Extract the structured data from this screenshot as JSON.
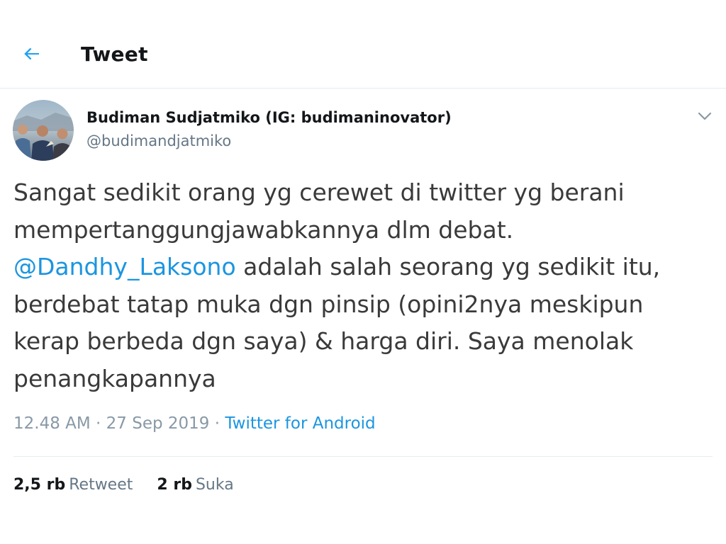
{
  "header": {
    "title": "Tweet",
    "back_icon": "arrow-left-icon",
    "accent_color": "#1da1f2"
  },
  "author": {
    "name": "Budiman Sudjatmiko (IG: budimaninovator)",
    "handle": "@budimandjatmiko",
    "avatar": "profile-photo"
  },
  "menu": {
    "icon": "chevron-down-icon"
  },
  "tweet": {
    "lines": [
      {
        "text": "Sangat sedikit orang yg cerewet di twitter yg berani"
      },
      {
        "text": "mempertanggungjawabkannya dlm debat."
      },
      {
        "mention": "@Dandhy_Laksono",
        "text": " adalah salah seorang yg sedikit itu,"
      },
      {
        "text": "berdebat tatap muka dgn pinsip (opini2nya meskipun"
      },
      {
        "text": "kerap berbeda dgn saya) & harga diri. Saya menolak"
      },
      {
        "text": "penangkapannya"
      }
    ]
  },
  "meta": {
    "time": "12.48 AM",
    "separator": " · ",
    "date": "27 Sep 2019",
    "source": "Twitter for Android"
  },
  "stats": {
    "retweets_count": "2,5 rb",
    "retweets_label": "Retweet",
    "likes_count": "2 rb",
    "likes_label": "Suka"
  },
  "colors": {
    "link": "#1b95e0",
    "secondary_text": "#657786",
    "divider": "#e6ecf0"
  }
}
